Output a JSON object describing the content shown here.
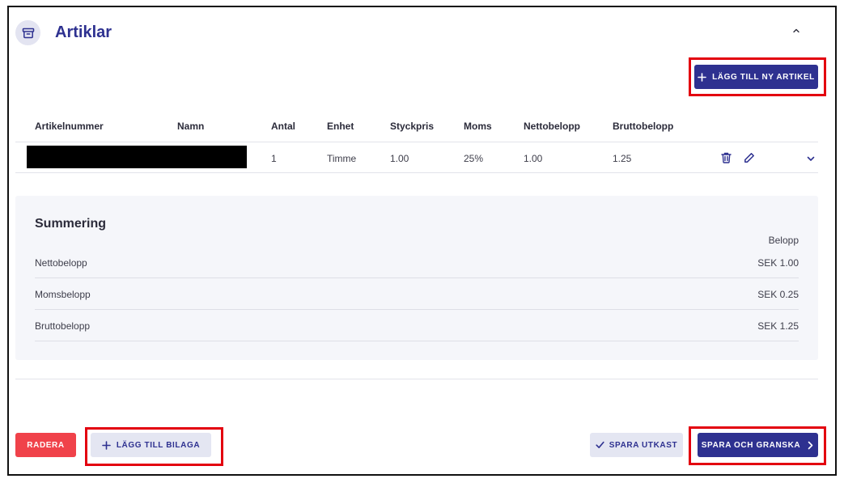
{
  "section": {
    "title": "Artiklar",
    "icon": "archive-box-icon",
    "collapse_icon": "chevron-up-icon"
  },
  "toolbar": {
    "add_article_label": "LÄGG TILL NY ARTIKEL"
  },
  "table": {
    "columns": [
      "Artikelnummer",
      "Namn",
      "Antal",
      "Enhet",
      "Styckpris",
      "Moms",
      "Nettobelopp",
      "Bruttobelopp"
    ],
    "rows": [
      {
        "antal": "1",
        "enhet": "Timme",
        "styckpris": "1.00",
        "moms": "25%",
        "nettobelopp": "1.00",
        "bruttobelopp": "1.25"
      }
    ]
  },
  "summary": {
    "title": "Summering",
    "amount_header": "Belopp",
    "rows": [
      {
        "label": "Nettobelopp",
        "value": "SEK 1.00"
      },
      {
        "label": "Momsbelopp",
        "value": "SEK 0.25"
      },
      {
        "label": "Bruttobelopp",
        "value": "SEK 1.25"
      }
    ]
  },
  "footer": {
    "delete_label": "RADERA",
    "add_attachment_label": "LÄGG TILL BILAGA",
    "save_draft_label": "SPARA UTKAST",
    "save_review_label": "SPARA OCH GRANSKA"
  },
  "colors": {
    "primary": "#2e3190",
    "secondary_bg": "#e4e6f2",
    "danger": "#f0424a",
    "highlight": "#e3000f"
  }
}
